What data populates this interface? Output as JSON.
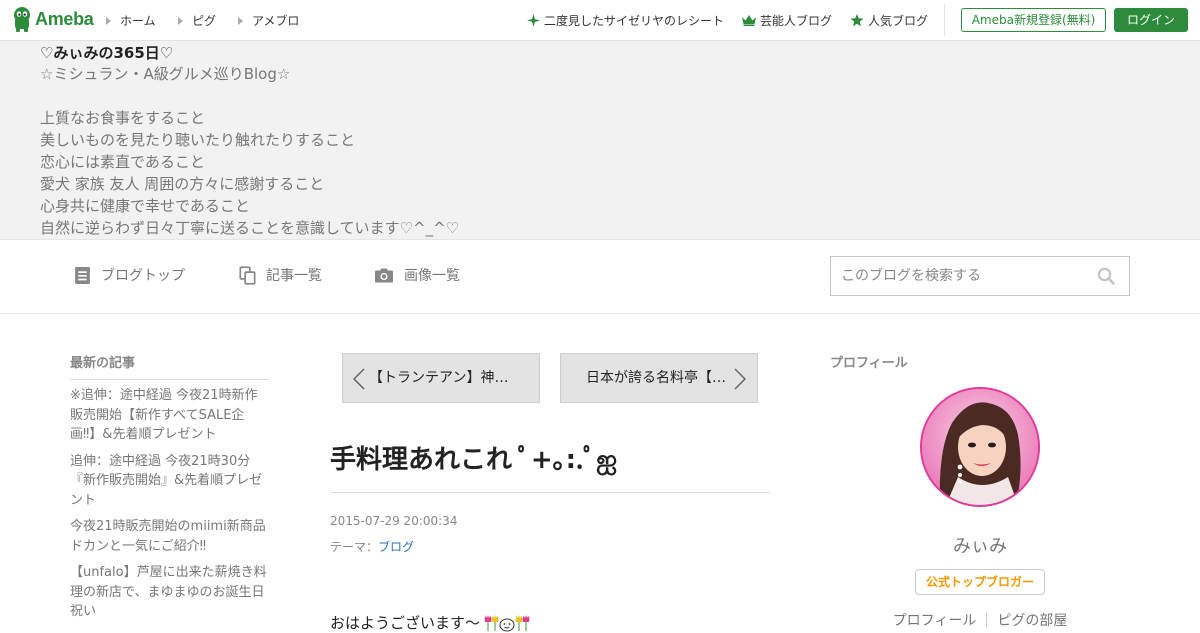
{
  "global_header": {
    "logo_text": "Ameba",
    "nav": [
      "ホーム",
      "ピグ",
      "アメブロ"
    ],
    "trending": "二度見したサイゼリヤのレシート",
    "celebrity_blog": "芸能人ブログ",
    "popular_blog": "人気ブログ",
    "register": "Ameba新規登録(無料)",
    "login": "ログイン",
    "brand_color": "#2d8c3c"
  },
  "blog_header": {
    "title": "♡みぃみの365日♡",
    "description_lines": [
      "☆ミシュラン・A級グルメ巡りBlog☆",
      "",
      "上質なお食事をすること",
      "美しいものを見たり聴いたり触れたりすること",
      "恋心には素直であること",
      "愛犬 家族 友人 周囲の方々に感謝すること",
      "心身共に健康で幸せであること",
      "自然に逆らわず日々丁寧に送ることを意識しています♡^_^♡"
    ]
  },
  "blog_nav": {
    "items": [
      {
        "label": "ブログトップ",
        "icon": "document-icon"
      },
      {
        "label": "記事一覧",
        "icon": "copy-icon"
      },
      {
        "label": "画像一覧",
        "icon": "camera-icon"
      }
    ],
    "search_placeholder": "このブログを検索する"
  },
  "sidebar_left": {
    "heading": "最新の記事",
    "recent_entries": [
      "※追伸：途中経過 今夜21時新作販売開始【新作すべてSALE企画‼︎】&先着順プレゼント",
      "追伸：途中経過 今夜21時30分『新作販売開始』&先着順プレゼント",
      "今夜21時販売開始のmiimi新商品 ドカンと一気にご紹介‼︎",
      "【unfalo】芦屋に出来た薪焼き料理の新店で、まゆまゆのお誕生日祝い"
    ]
  },
  "entry": {
    "prev_title": "【トランテアン】神戸のフレンチ",
    "next_title": "日本が誇る名料亭【吉兆】",
    "title": "手料理あれこれ ﾟ+｡:.ﾟஐ",
    "date": "2015-07-29 20:00:34",
    "theme_label": "テーマ：",
    "theme": "ブログ",
    "body_first_line": "おはようございます～"
  },
  "sidebar_right": {
    "heading": "プロフィール",
    "name": "みぃみ",
    "badge": "公式トップブロガー",
    "links": [
      "プロフィール",
      "ピグの部屋"
    ]
  }
}
